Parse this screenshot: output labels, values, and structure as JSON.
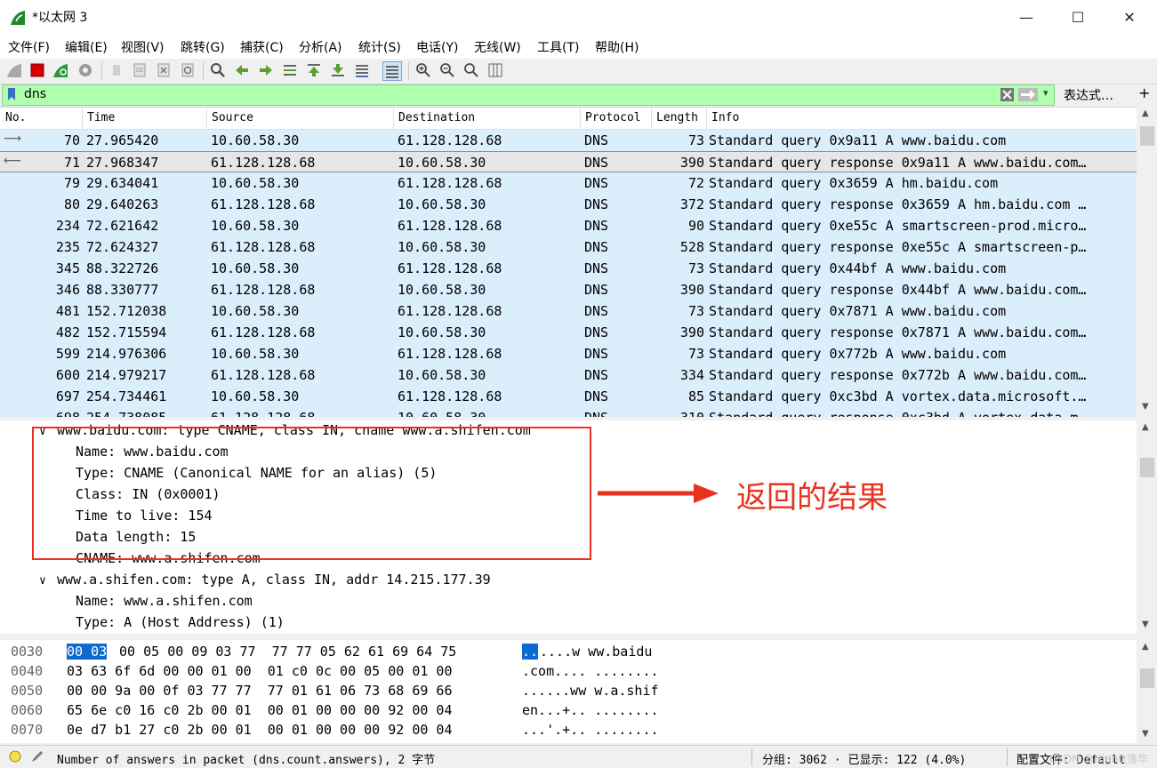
{
  "window": {
    "title": "*以太网 3",
    "minimize": "—",
    "maximize": "☐",
    "close": "✕"
  },
  "menu": [
    "文件(F)",
    "编辑(E)",
    "视图(V)",
    "跳转(G)",
    "捕获(C)",
    "分析(A)",
    "统计(S)",
    "电话(Y)",
    "无线(W)",
    "工具(T)",
    "帮助(H)"
  ],
  "filter": {
    "value": "dns",
    "expression_label": "表达式…",
    "plus": "+"
  },
  "packet_list": {
    "columns": [
      "No.",
      "Time",
      "Source",
      "Destination",
      "Protocol",
      "Length",
      "Info"
    ],
    "rows": [
      {
        "no": "70",
        "time": "27.965420",
        "src": "10.60.58.30",
        "dst": "61.128.128.68",
        "proto": "DNS",
        "len": "73",
        "info": "Standard query 0x9a11 A www.baidu.com"
      },
      {
        "no": "71",
        "time": "27.968347",
        "src": "61.128.128.68",
        "dst": "10.60.58.30",
        "proto": "DNS",
        "len": "390",
        "info": "Standard query response 0x9a11 A www.baidu.com…"
      },
      {
        "no": "79",
        "time": "29.634041",
        "src": "10.60.58.30",
        "dst": "61.128.128.68",
        "proto": "DNS",
        "len": "72",
        "info": "Standard query 0x3659 A hm.baidu.com"
      },
      {
        "no": "80",
        "time": "29.640263",
        "src": "61.128.128.68",
        "dst": "10.60.58.30",
        "proto": "DNS",
        "len": "372",
        "info": "Standard query response 0x3659 A hm.baidu.com …"
      },
      {
        "no": "234",
        "time": "72.621642",
        "src": "10.60.58.30",
        "dst": "61.128.128.68",
        "proto": "DNS",
        "len": "90",
        "info": "Standard query 0xe55c A smartscreen-prod.micro…"
      },
      {
        "no": "235",
        "time": "72.624327",
        "src": "61.128.128.68",
        "dst": "10.60.58.30",
        "proto": "DNS",
        "len": "528",
        "info": "Standard query response 0xe55c A smartscreen-p…"
      },
      {
        "no": "345",
        "time": "88.322726",
        "src": "10.60.58.30",
        "dst": "61.128.128.68",
        "proto": "DNS",
        "len": "73",
        "info": "Standard query 0x44bf A www.baidu.com"
      },
      {
        "no": "346",
        "time": "88.330777",
        "src": "61.128.128.68",
        "dst": "10.60.58.30",
        "proto": "DNS",
        "len": "390",
        "info": "Standard query response 0x44bf A www.baidu.com…"
      },
      {
        "no": "481",
        "time": "152.712038",
        "src": "10.60.58.30",
        "dst": "61.128.128.68",
        "proto": "DNS",
        "len": "73",
        "info": "Standard query 0x7871 A www.baidu.com"
      },
      {
        "no": "482",
        "time": "152.715594",
        "src": "61.128.128.68",
        "dst": "10.60.58.30",
        "proto": "DNS",
        "len": "390",
        "info": "Standard query response 0x7871 A www.baidu.com…"
      },
      {
        "no": "599",
        "time": "214.976306",
        "src": "10.60.58.30",
        "dst": "61.128.128.68",
        "proto": "DNS",
        "len": "73",
        "info": "Standard query 0x772b A www.baidu.com"
      },
      {
        "no": "600",
        "time": "214.979217",
        "src": "61.128.128.68",
        "dst": "10.60.58.30",
        "proto": "DNS",
        "len": "334",
        "info": "Standard query response 0x772b A www.baidu.com…"
      },
      {
        "no": "697",
        "time": "254.734461",
        "src": "10.60.58.30",
        "dst": "61.128.128.68",
        "proto": "DNS",
        "len": "85",
        "info": "Standard query 0xc3bd A vortex.data.microsoft.…"
      },
      {
        "no": "698",
        "time": "254.738085",
        "src": "61.128.128.68",
        "dst": "10.60.58.30",
        "proto": "DNS",
        "len": "310",
        "info": "Standard query response 0xc3bd A vortex.data.m…"
      }
    ]
  },
  "details": {
    "lines": [
      {
        "indent": 0,
        "arrow": "∨",
        "text": "www.baidu.com: type CNAME, class IN, cname www.a.shifen.com"
      },
      {
        "indent": 1,
        "arrow": "",
        "text": "Name: www.baidu.com"
      },
      {
        "indent": 1,
        "arrow": "",
        "text": "Type: CNAME (Canonical NAME for an alias) (5)"
      },
      {
        "indent": 1,
        "arrow": "",
        "text": "Class: IN (0x0001)"
      },
      {
        "indent": 1,
        "arrow": "",
        "text": "Time to live: 154"
      },
      {
        "indent": 1,
        "arrow": "",
        "text": "Data length: 15"
      },
      {
        "indent": 1,
        "arrow": "",
        "text": "CNAME: www.a.shifen.com"
      },
      {
        "indent": 0,
        "arrow": "∨",
        "text": "www.a.shifen.com: type A, class IN, addr 14.215.177.39"
      },
      {
        "indent": 1,
        "arrow": "",
        "text": "Name: www.a.shifen.com"
      },
      {
        "indent": 1,
        "arrow": "",
        "text": "Type: A (Host Address) (1)"
      }
    ]
  },
  "bytes": {
    "rows": [
      {
        "offset": "0030",
        "hex_sel": "00 03",
        "hex_rest": " 00 05 00 09 03 77  77 77 05 62 61 69 64 75",
        "ascii_sel": "..",
        "ascii_rest": "....w ww.baidu"
      },
      {
        "offset": "0040",
        "hex_sel": "",
        "hex_rest": "03 63 6f 6d 00 00 01 00  01 c0 0c 00 05 00 01 00",
        "ascii_sel": "",
        "ascii_rest": ".com.... ........"
      },
      {
        "offset": "0050",
        "hex_sel": "",
        "hex_rest": "00 00 9a 00 0f 03 77 77  77 01 61 06 73 68 69 66",
        "ascii_sel": "",
        "ascii_rest": "......ww w.a.shif"
      },
      {
        "offset": "0060",
        "hex_sel": "",
        "hex_rest": "65 6e c0 16 c0 2b 00 01  00 01 00 00 00 92 00 04",
        "ascii_sel": "",
        "ascii_rest": "en...+.. ........"
      },
      {
        "offset": "0070",
        "hex_sel": "",
        "hex_rest": "0e d7 b1 27 c0 2b 00 01  00 01 00 00 00 92 00 04",
        "ascii_sel": "",
        "ascii_rest": "...'.+.. ........"
      }
    ]
  },
  "status": {
    "field_info": "Number of answers in packet (dns.count.answers), 2 字节",
    "packets": "分组: 3062 · 已显示: 122 (4.0%)",
    "profile": "配置文件: Default",
    "watermark": "CSDN @Nightt落华"
  },
  "annotation": {
    "text": "返回的结果",
    "color": "#e8321e"
  },
  "colors": {
    "row_bg": "#dbeefc",
    "filter_bg": "#afffaf",
    "selection": "#0b6bd3"
  }
}
